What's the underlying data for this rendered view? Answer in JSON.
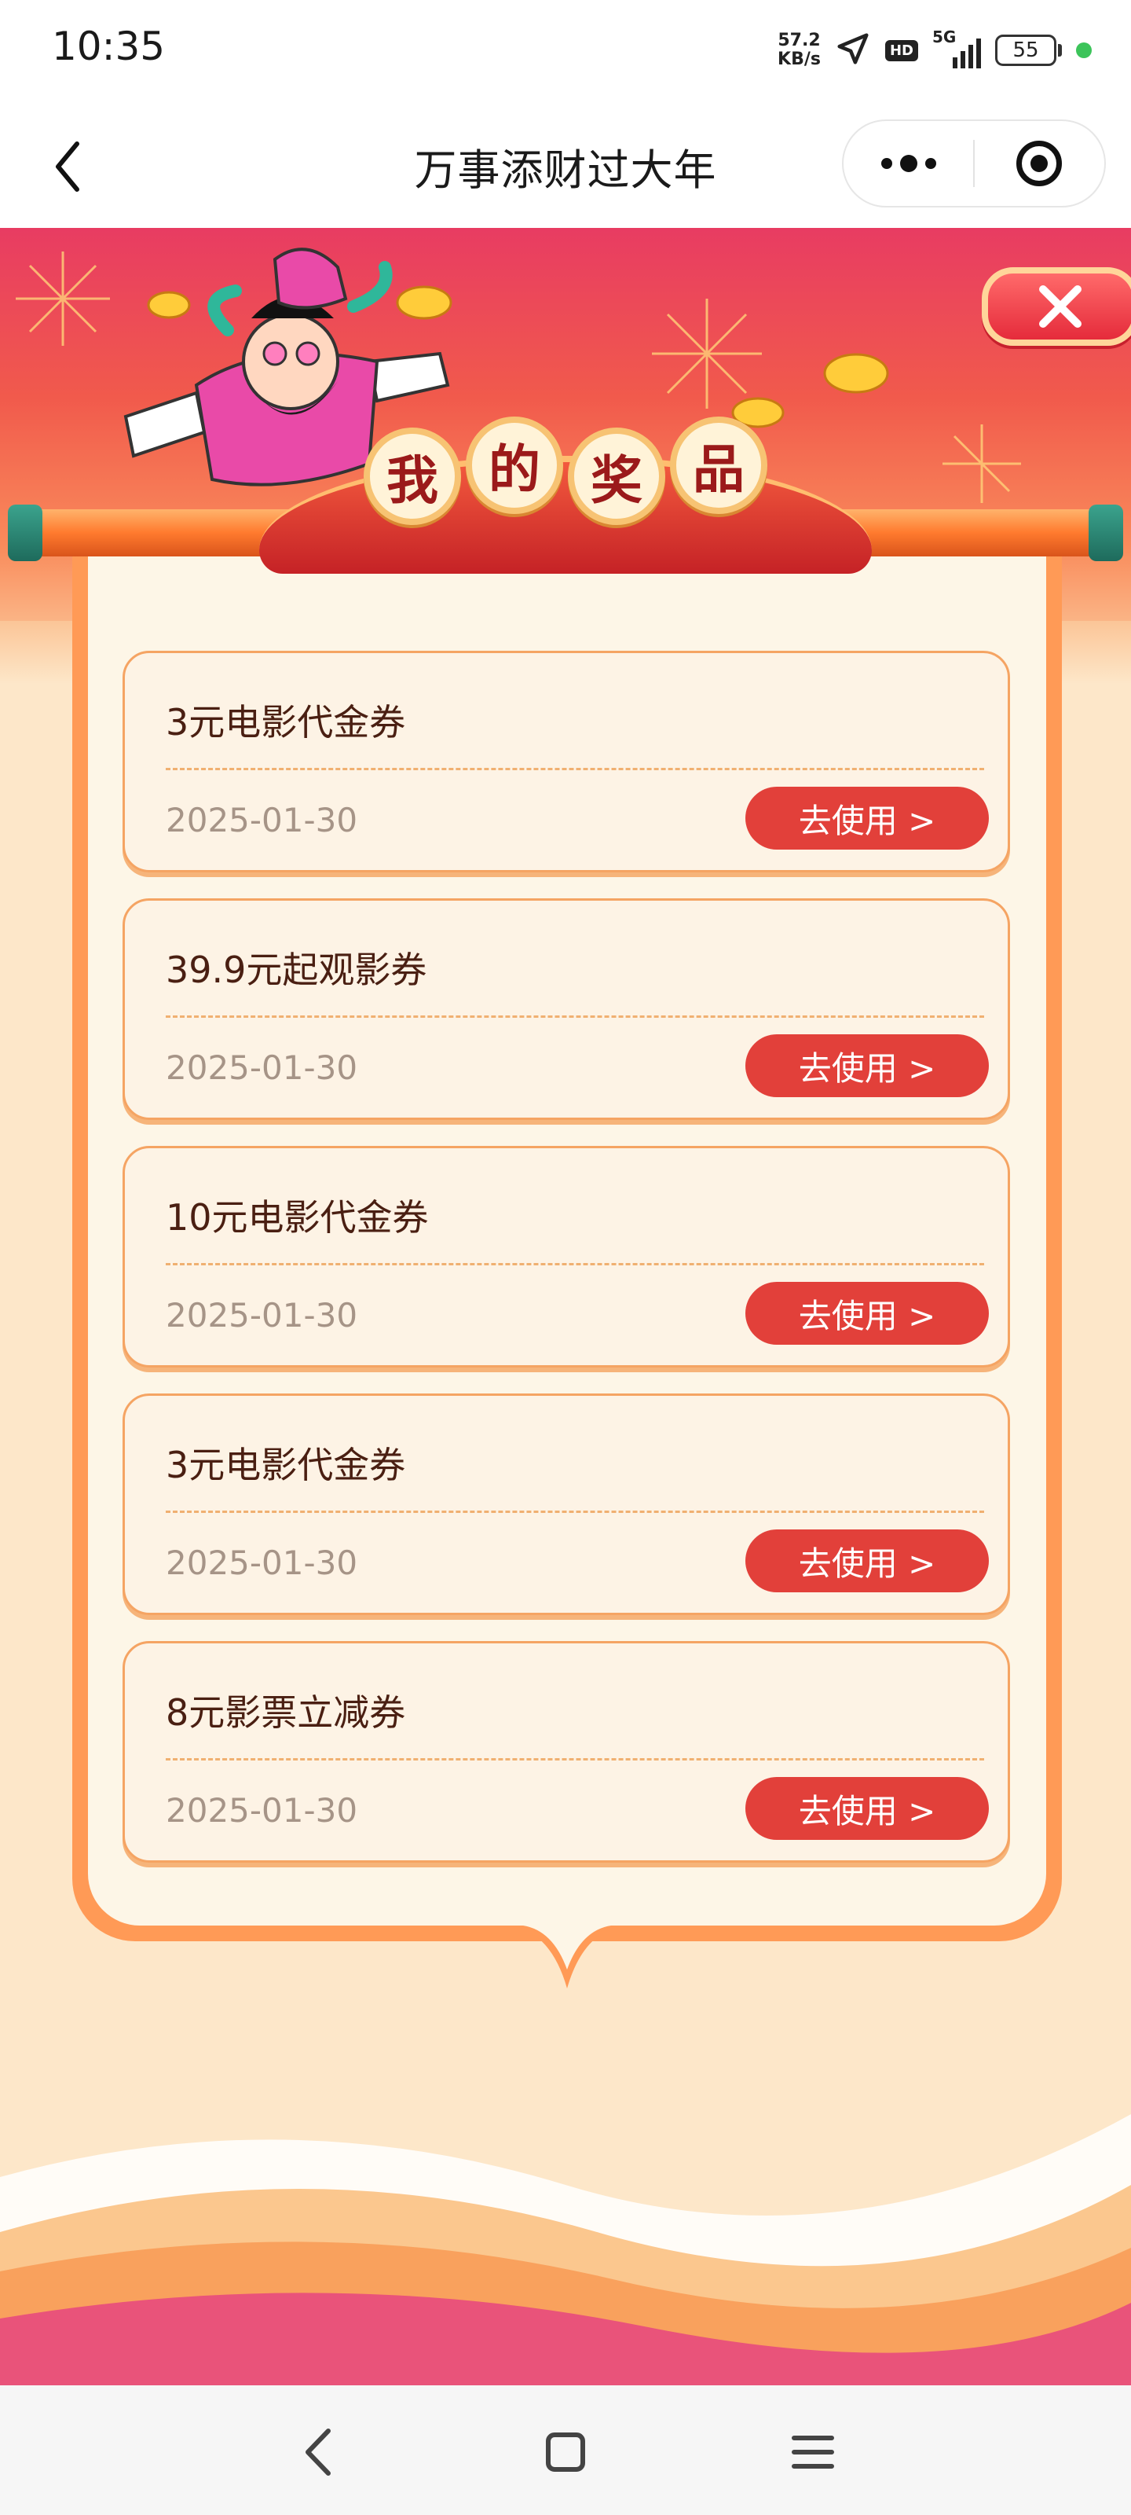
{
  "status_bar": {
    "time": "10:35",
    "net_speed_value": "57.2",
    "net_speed_unit": "KB/s",
    "hd": "HD",
    "network": "5G",
    "battery": "55"
  },
  "nav": {
    "title": "万事添财过大年"
  },
  "banner": {
    "chars": [
      "我",
      "的",
      "奖",
      "品"
    ]
  },
  "prizes": [
    {
      "name": "3元电影代金券",
      "date": "2025-01-30",
      "button": "去使用 >"
    },
    {
      "name": "39.9元起观影券",
      "date": "2025-01-30",
      "button": "去使用 >"
    },
    {
      "name": "10元电影代金券",
      "date": "2025-01-30",
      "button": "去使用 >"
    },
    {
      "name": "3元电影代金券",
      "date": "2025-01-30",
      "button": "去使用 >"
    },
    {
      "name": "8元影票立减券",
      "date": "2025-01-30",
      "button": "去使用 >"
    }
  ],
  "colors": {
    "accent_red": "#e2403a",
    "paper": "#fdf6e7",
    "card_border": "#f5a463",
    "page_bg": "#fde7c9"
  }
}
